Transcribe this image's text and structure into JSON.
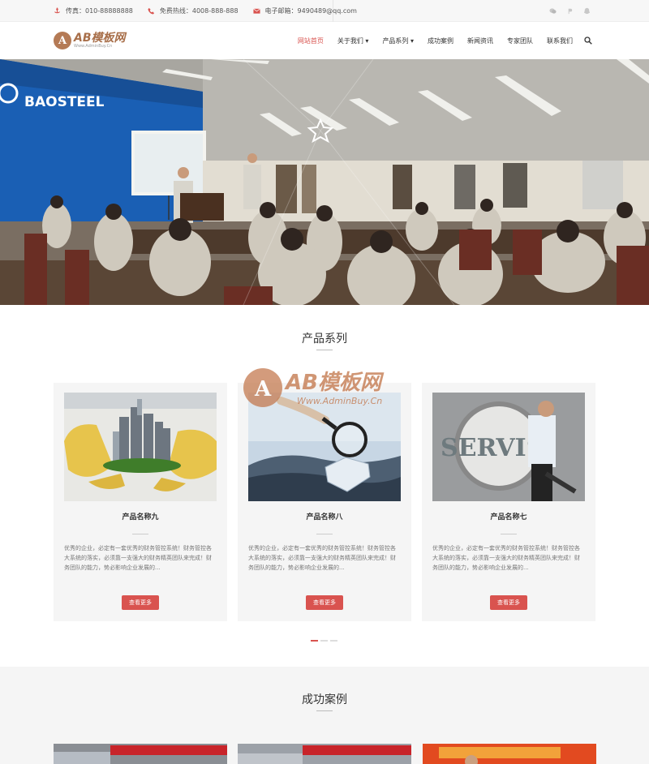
{
  "topbar": {
    "fax": "传真：010-88888888",
    "hotline": "免费热线：4008-888-888",
    "email": "电子邮箱：9490489@qq.com",
    "social": [
      "wechat-icon",
      "weibo-icon",
      "qq-icon"
    ]
  },
  "logo": {
    "mark": "A",
    "text": "AB模板网",
    "sub": "Www.AdminBuy.Cn"
  },
  "nav": {
    "items": [
      {
        "label": "网站首页",
        "active": true
      },
      {
        "label": "关于我们 ▾",
        "active": false
      },
      {
        "label": "产品系列 ▾",
        "active": false
      },
      {
        "label": "成功案例",
        "active": false
      },
      {
        "label": "新闻资讯",
        "active": false
      },
      {
        "label": "专家团队",
        "active": false
      },
      {
        "label": "联系我们",
        "active": false
      }
    ]
  },
  "hero": {
    "banner_text": "BAOSTEEL"
  },
  "products": {
    "title": "产品系列",
    "cards": [
      {
        "name": "产品名称九",
        "desc": "优秀的企业，必定有一套优秀的财务管控系统！财务管控各大系统的落实，必须靠一支强大的财务精英团队来完成！财务团队的能力，势必影响企业发展的...",
        "button": "查看更多"
      },
      {
        "name": "产品名称八",
        "desc": "优秀的企业，必定有一套优秀的财务管控系统！财务管控各大系统的落实，必须靠一支强大的财务精英团队来完成！财务团队的能力，势必影响企业发展的...",
        "button": "查看更多"
      },
      {
        "name": "产品名称七",
        "desc": "优秀的企业，必定有一套优秀的财务管控系统！财务管控各大系统的落实，必须靠一支强大的财务精英团队来完成！财务团队的能力，势必影响企业发展的...",
        "button": "查看更多"
      }
    ],
    "servis_text": "SERVIS",
    "carousel_pages": 3,
    "carousel_active": 0
  },
  "cases": {
    "title": "成功案例"
  },
  "watermark": {
    "main": "AB模板网",
    "sub": "Www.AdminBuy.Cn"
  },
  "colors": {
    "accent": "#d9534f",
    "logo": "#a86f4a",
    "card_bg": "#f5f5f5"
  }
}
